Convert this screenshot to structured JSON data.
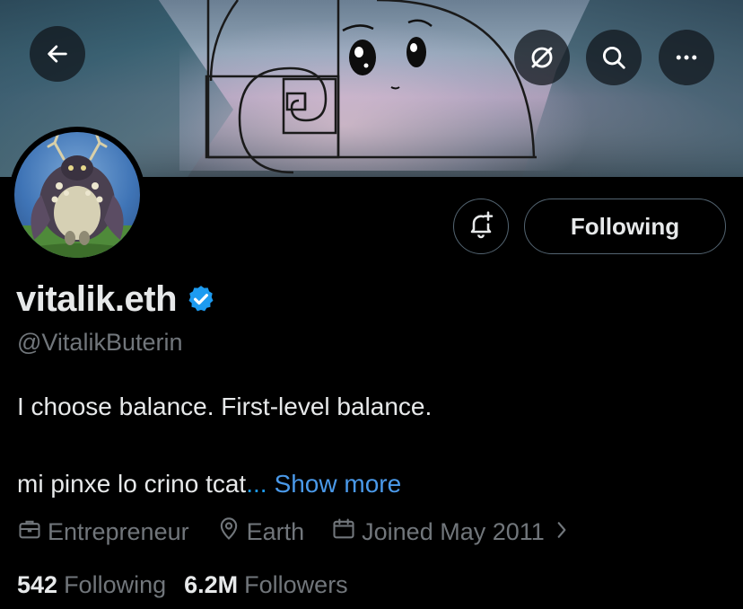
{
  "profile": {
    "display_name": "vitalik.eth",
    "handle": "@VitalikButerin",
    "bio_line1": "I choose balance. First-level balance.",
    "bio_line2": "mi pinxe lo crino tcat",
    "bio_ellipsis": "...",
    "show_more_label": "Show more",
    "category": "Entrepreneur",
    "location": "Earth",
    "joined": "Joined May 2011",
    "following_count": "542",
    "following_label": "Following",
    "followers_count": "6.2M",
    "followers_label": "Followers"
  },
  "actions": {
    "following_button_label": "Following"
  },
  "icons": {
    "back": "arrow-left-icon",
    "grok": "grok-icon",
    "search": "search-icon",
    "more": "more-dots-icon",
    "notify": "bell-plus-icon",
    "verified": "verified-badge-icon",
    "category": "briefcase-icon",
    "location": "location-pin-icon",
    "joined": "calendar-icon",
    "chevron": "chevron-right-icon"
  },
  "colors": {
    "background": "#000000",
    "primary_text": "#e7e9ea",
    "secondary_text": "#71767b",
    "link": "#4a99e9",
    "verified": "#1d9bf0"
  }
}
